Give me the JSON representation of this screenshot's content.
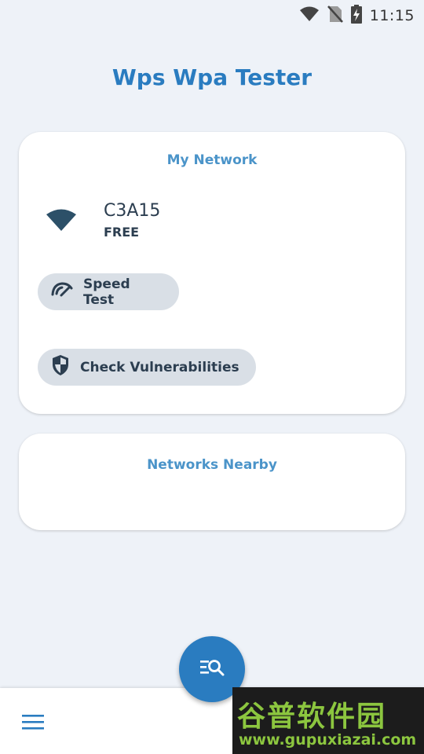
{
  "status_bar": {
    "time": "11:15",
    "icons": [
      "wifi-signal-icon",
      "no-sim-icon",
      "battery-charging-icon"
    ]
  },
  "app": {
    "title": "Wps Wpa Tester"
  },
  "my_network": {
    "title": "My Network",
    "ssid": "C3A15",
    "security": "FREE",
    "icon": "wifi-icon",
    "actions": {
      "speed_test": "Speed Test",
      "check_vulnerabilities": "Check Vulnerabilities"
    }
  },
  "networks_nearby": {
    "title": "Networks Nearby"
  },
  "bottom_bar": {
    "menu_icon": "hamburger-menu-icon",
    "fab_icon": "search-list-icon"
  },
  "watermark": {
    "cn_text": "谷普软件园",
    "url": "www.gupuxiazai.com"
  },
  "colors": {
    "primary": "#2a7cc0",
    "card_title": "#4b94c9",
    "text_dark": "#2c3e50",
    "pill_bg": "#d9dfe6",
    "background": "#eef2f8"
  }
}
